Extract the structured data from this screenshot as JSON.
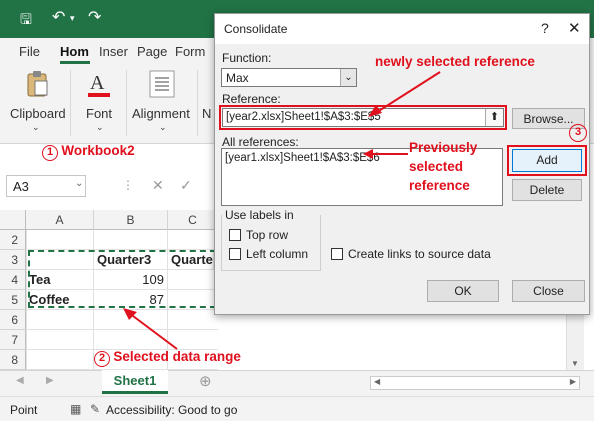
{
  "ribbon": {
    "tabs": [
      "File",
      "Hom",
      "Inser",
      "Page",
      "Form"
    ],
    "groups": [
      {
        "label": "Clipboard",
        "icon": "clipboard-icon"
      },
      {
        "label": "Font",
        "icon": "font-icon"
      },
      {
        "label": "Alignment",
        "icon": "alignment-icon"
      },
      {
        "label": "N",
        "icon": "number-icon"
      }
    ]
  },
  "formula_bar": {
    "name_box": "A3"
  },
  "grid": {
    "columns": [
      "A",
      "B",
      "C"
    ],
    "rows": [
      "2",
      "3",
      "4",
      "5",
      "6",
      "7",
      "8"
    ],
    "cells": {
      "b3": "Quarter3",
      "c3": "Quarte",
      "a4": "Tea",
      "b4": "109",
      "a5": "Coffee",
      "b5": "87"
    }
  },
  "sheet_tabs": {
    "active": "Sheet1"
  },
  "status_bar": {
    "mode": "Point",
    "accessibility": "Accessibility: Good to go"
  },
  "dialog": {
    "title": "Consolidate",
    "help": "?",
    "function_label": "Function:",
    "function_value": "Max",
    "reference_label": "Reference:",
    "reference_value": "[year2.xlsx]Sheet1!$A$3:$E$5",
    "browse_label": "Browse...",
    "all_references_label": "All references:",
    "all_references": [
      "[year1.xlsx]Sheet1!$A$3:$E$6"
    ],
    "add_label": "Add",
    "delete_label": "Delete",
    "use_labels_in": "Use labels in",
    "top_row": "Top row",
    "left_column": "Left column",
    "create_links": "Create links to source data",
    "ok_label": "OK",
    "close_label": "Close"
  },
  "annotations": {
    "workbook_num": "1",
    "workbook_text": "Workbook2",
    "range_num": "2",
    "range_text": "Selected data range",
    "add_num": "3",
    "new_ref": "newly selected reference",
    "prev_ref_1": "Previously",
    "prev_ref_2": "selected",
    "prev_ref_3": "reference"
  },
  "colors": {
    "excel_green": "#217346",
    "annotation_red": "#e0101d"
  }
}
